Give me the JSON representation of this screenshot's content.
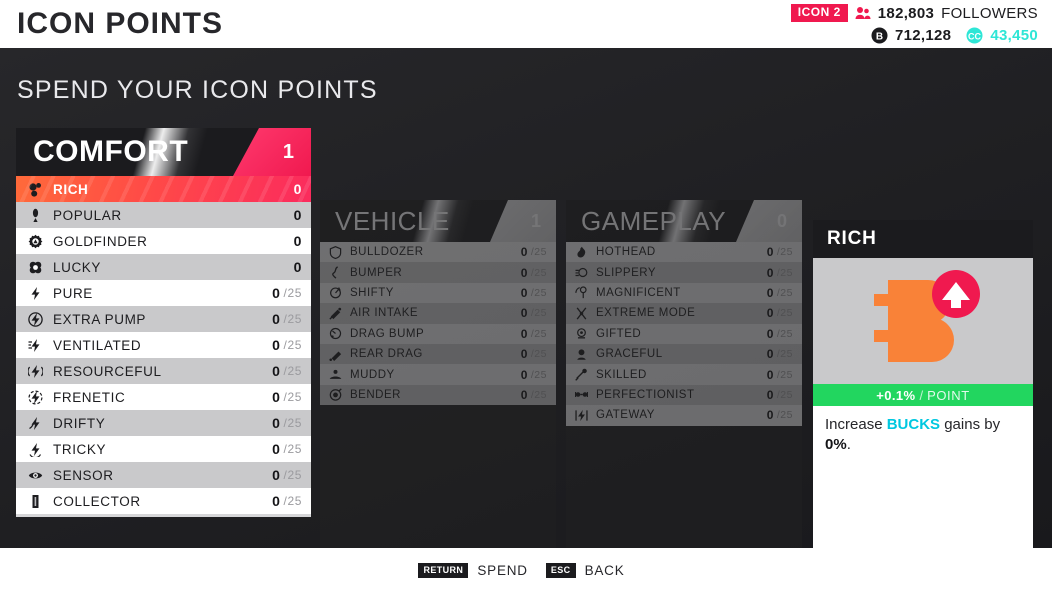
{
  "header": {
    "title": "ICON POINTS",
    "badge": "ICON 2",
    "followers_value": "182,803",
    "followers_label": "FOLLOWERS",
    "bucks_value": "712,128",
    "cc_value": "43,450",
    "followers_icon": "people-icon",
    "bucks_icon": "bucks-coin-icon",
    "cc_icon": "cc-coin-icon",
    "accent_pink": "#f0194f",
    "accent_teal": "#2ee6d6"
  },
  "subtitle": "SPEND YOUR ICON POINTS",
  "panels": [
    {
      "name": "COMFORT",
      "count": "1",
      "active": true,
      "items": [
        {
          "label": "RICH",
          "value": "0",
          "max": "",
          "icon": "bucks-icon",
          "selected": true
        },
        {
          "label": "POPULAR",
          "value": "0",
          "max": "",
          "icon": "person-icon",
          "selected": false
        },
        {
          "label": "GOLDFINDER",
          "value": "0",
          "max": "",
          "icon": "gear-coin-icon",
          "selected": false
        },
        {
          "label": "LUCKY",
          "value": "0",
          "max": "",
          "icon": "clover-icon",
          "selected": false
        },
        {
          "label": "PURE",
          "value": "0",
          "max": "/25",
          "icon": "bolt-icon",
          "selected": false
        },
        {
          "label": "EXTRA PUMP",
          "value": "0",
          "max": "/25",
          "icon": "bolt-circle-icon",
          "selected": false
        },
        {
          "label": "VENTILATED",
          "value": "0",
          "max": "/25",
          "icon": "bolt-wind-icon",
          "selected": false
        },
        {
          "label": "RESOURCEFUL",
          "value": "0",
          "max": "/25",
          "icon": "bolt-radio-icon",
          "selected": false
        },
        {
          "label": "FRENETIC",
          "value": "0",
          "max": "/25",
          "icon": "bolt-ring-icon",
          "selected": false
        },
        {
          "label": "DRIFTY",
          "value": "0",
          "max": "/25",
          "icon": "bolt-drift-icon",
          "selected": false
        },
        {
          "label": "TRICKY",
          "value": "0",
          "max": "/25",
          "icon": "bolt-trick-icon",
          "selected": false
        },
        {
          "label": "SENSOR",
          "value": "0",
          "max": "/25",
          "icon": "eye-icon",
          "selected": false
        },
        {
          "label": "COLLECTOR",
          "value": "0",
          "max": "/25",
          "icon": "battery-icon",
          "selected": false
        }
      ]
    },
    {
      "name": "VEHICLE",
      "count": "1",
      "active": false,
      "items": [
        {
          "label": "BULLDOZER",
          "value": "0",
          "max": "/25",
          "icon": "shield-icon",
          "selected": false
        },
        {
          "label": "BUMPER",
          "value": "0",
          "max": "/25",
          "icon": "swerve-icon",
          "selected": false
        },
        {
          "label": "SHIFTY",
          "value": "0",
          "max": "/25",
          "icon": "turn-icon",
          "selected": false
        },
        {
          "label": "AIR INTAKE",
          "value": "0",
          "max": "/25",
          "icon": "intake-icon",
          "selected": false
        },
        {
          "label": "DRAG BUMP",
          "value": "0",
          "max": "/25",
          "icon": "drag-icon",
          "selected": false
        },
        {
          "label": "REAR DRAG",
          "value": "0",
          "max": "/25",
          "icon": "rear-drag-icon",
          "selected": false
        },
        {
          "label": "MUDDY",
          "value": "0",
          "max": "/25",
          "icon": "mud-icon",
          "selected": false
        },
        {
          "label": "BENDER",
          "value": "0",
          "max": "/25",
          "icon": "bend-icon",
          "selected": false
        }
      ]
    },
    {
      "name": "GAMEPLAY",
      "count": "0",
      "active": false,
      "items": [
        {
          "label": "HOTHEAD",
          "value": "0",
          "max": "/25",
          "icon": "flame-icon",
          "selected": false
        },
        {
          "label": "SLIPPERY",
          "value": "0",
          "max": "/25",
          "icon": "slip-icon",
          "selected": false
        },
        {
          "label": "MAGNIFICENT",
          "value": "0",
          "max": "/25",
          "icon": "star-pin-icon",
          "selected": false
        },
        {
          "label": "EXTREME MODE",
          "value": "0",
          "max": "/25",
          "icon": "extreme-icon",
          "selected": false
        },
        {
          "label": "GIFTED",
          "value": "0",
          "max": "/25",
          "icon": "gift-icon",
          "selected": false
        },
        {
          "label": "GRACEFUL",
          "value": "0",
          "max": "/25",
          "icon": "grace-icon",
          "selected": false
        },
        {
          "label": "SKILLED",
          "value": "0",
          "max": "/25",
          "icon": "skill-icon",
          "selected": false
        },
        {
          "label": "PERFECTIONIST",
          "value": "0",
          "max": "/25",
          "icon": "perfection-icon",
          "selected": false
        },
        {
          "label": "GATEWAY",
          "value": "0",
          "max": "/25",
          "icon": "gateway-icon",
          "selected": false
        }
      ]
    }
  ],
  "detail": {
    "title": "RICH",
    "art_icon": "bucks-upgrade-icon",
    "rate_value": "+0.1%",
    "rate_sep": "/",
    "rate_unit": "POINT",
    "desc_pre": "Increase ",
    "desc_currency": "BUCKS",
    "desc_mid": " gains by ",
    "desc_amount": "0%",
    "desc_post": ".",
    "bar_color": "#22d65f",
    "currency_color": "#00c8e0"
  },
  "footer": {
    "actions": [
      {
        "key": "RETURN",
        "label": "SPEND"
      },
      {
        "key": "ESC",
        "label": "BACK"
      }
    ]
  }
}
